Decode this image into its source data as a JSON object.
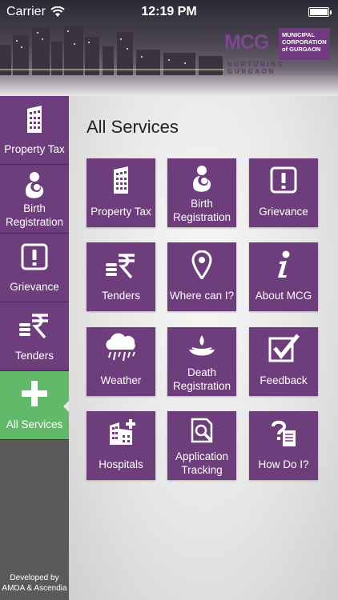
{
  "status_bar": {
    "carrier": "Carrier",
    "time": "12:19 PM"
  },
  "logo": {
    "mcg": "MCG",
    "box": "MUNICIPAL CORPORATION of GURGAON",
    "tagline": "NURTURING GURGAON"
  },
  "sidebar": {
    "items": [
      {
        "label": "Property Tax",
        "icon": "building-icon"
      },
      {
        "label": "Birth Registration",
        "icon": "mother-baby-icon"
      },
      {
        "label": "Grievance",
        "icon": "exclamation-icon"
      },
      {
        "label": "Tenders",
        "icon": "rupee-coins-icon"
      },
      {
        "label": "All Services",
        "icon": "plus-icon",
        "active": true
      }
    ],
    "credit": "Developed by AMDA &  Ascendia"
  },
  "main": {
    "title": "All Services",
    "tiles": [
      {
        "label": "Property Tax",
        "icon": "building-icon"
      },
      {
        "label": "Birth Registration",
        "icon": "mother-baby-icon"
      },
      {
        "label": "Grievance",
        "icon": "exclamation-icon"
      },
      {
        "label": "Tenders",
        "icon": "rupee-coins-icon"
      },
      {
        "label": "Where can I?",
        "icon": "location-pin-icon"
      },
      {
        "label": "About MCG",
        "icon": "info-icon"
      },
      {
        "label": "Weather",
        "icon": "rain-cloud-icon"
      },
      {
        "label": "Death Registration",
        "icon": "diya-lamp-icon"
      },
      {
        "label": "Feedback",
        "icon": "checkbox-icon"
      },
      {
        "label": "Hospitals",
        "icon": "hospital-icon"
      },
      {
        "label": "Application Tracking",
        "icon": "document-search-icon"
      },
      {
        "label": "How Do I?",
        "icon": "question-document-icon"
      }
    ]
  },
  "colors": {
    "tile": "#6d3d7c",
    "active": "#63b96a",
    "sidebar_bg": "#5a5a5a"
  }
}
